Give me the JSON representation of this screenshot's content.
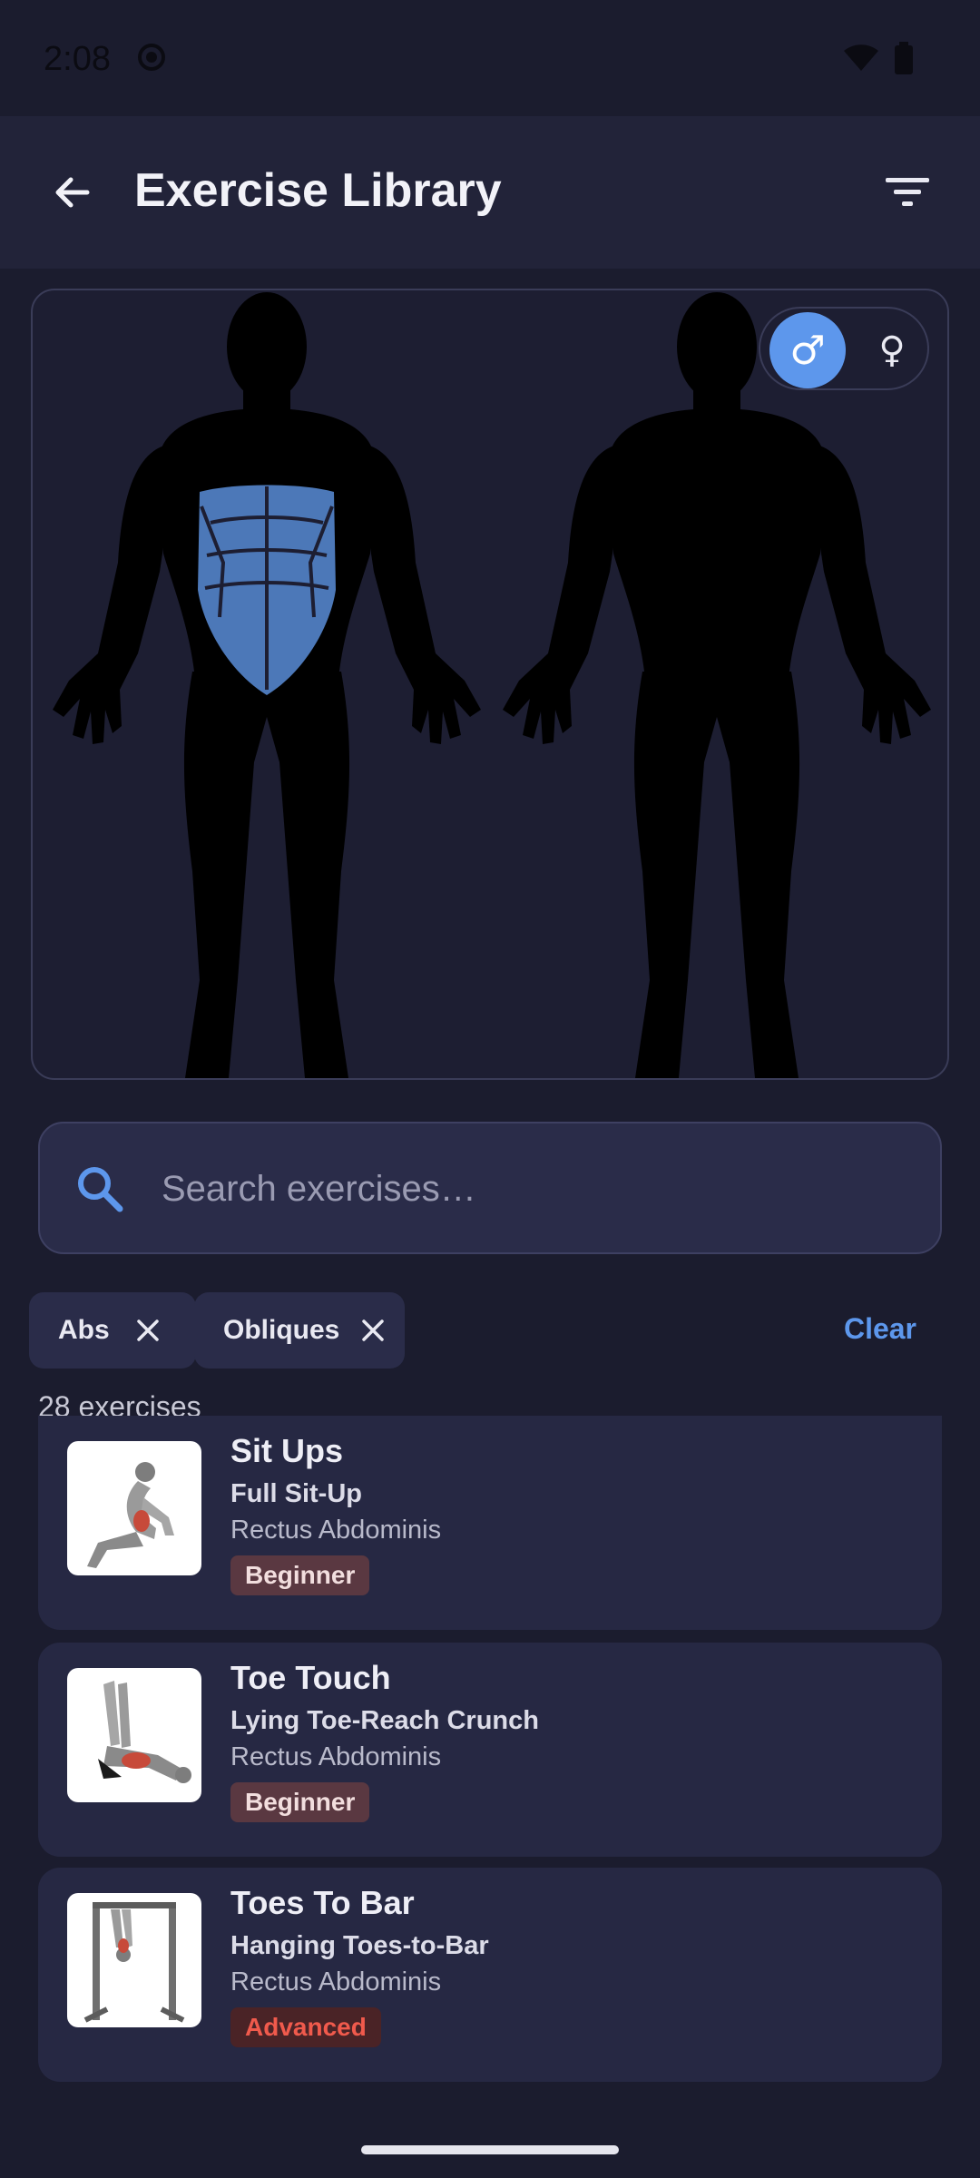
{
  "status_bar": {
    "time": "2:08",
    "icons": [
      "circle-status-icon",
      "wifi-icon",
      "battery-icon"
    ]
  },
  "app_bar": {
    "title": "Exercise Library",
    "back_icon": "arrow-left-icon",
    "filter_icon": "filter-lines-icon"
  },
  "body_map": {
    "front_view": "front-body-silhouette",
    "back_view": "back-body-silhouette",
    "highlighted_muscle": "abs",
    "highlight_color": "#4c78b8",
    "gender_toggle": {
      "male_symbol": "♂",
      "female_symbol": "♀",
      "selected": "male"
    }
  },
  "search": {
    "placeholder": "Search exercises…",
    "value": ""
  },
  "filters": {
    "chips": [
      {
        "label": "Abs"
      },
      {
        "label": "Obliques"
      }
    ],
    "clear_label": "Clear"
  },
  "results": {
    "count_label": "28 exercises",
    "exercises": [
      {
        "name": "Sit Ups",
        "subtitle": "Full Sit-Up",
        "muscle": "Rectus Abdominis",
        "level": "Beginner"
      },
      {
        "name": "Toe Touch",
        "subtitle": "Lying Toe-Reach Crunch",
        "muscle": "Rectus Abdominis",
        "level": "Beginner"
      },
      {
        "name": "Toes To Bar",
        "subtitle": "Hanging Toes-to-Bar",
        "muscle": "Rectus Abdominis",
        "level": "Advanced"
      }
    ]
  },
  "colors": {
    "accent": "#5d97ec",
    "background": "#1b1c2e",
    "card": "#262843",
    "beginner_badge": "#5a3841",
    "advanced_text": "#f05a4c"
  }
}
